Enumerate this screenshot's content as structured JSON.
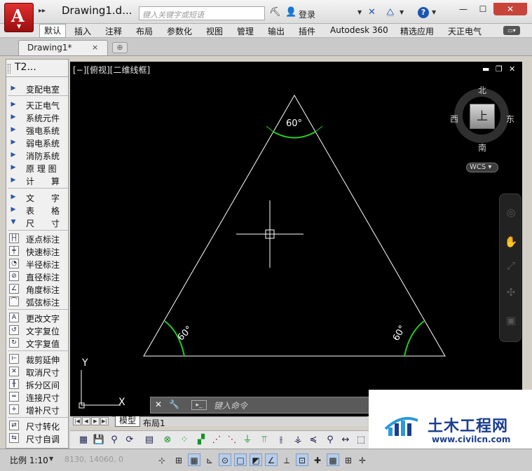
{
  "titlebar": {
    "app_glyph": "A",
    "title": "Drawing1.d...",
    "search_placeholder": "键入关键字或短语",
    "login": "登录"
  },
  "ribbon": {
    "tabs": [
      "默认",
      "插入",
      "注释",
      "布局",
      "参数化",
      "视图",
      "管理",
      "输出",
      "插件",
      "Autodesk 360",
      "精选应用",
      "天正电气"
    ]
  },
  "doc_tabs": {
    "active": "Drawing1*",
    "close": "×"
  },
  "palette": {
    "title": "T2...",
    "categories": [
      "变配电室",
      "天正电气",
      "系统元件",
      "强电系统",
      "弱电系统",
      "消防系统",
      "原 理 图",
      "计　　算",
      "文　　字",
      "表　　格",
      "尺　　寸"
    ],
    "tools": [
      "逐点标注",
      "快速标注",
      "半径标注",
      "直径标注",
      "角度标注",
      "弧弦标注",
      "更改文字",
      "文字复位",
      "文字复值",
      "裁剪延伸",
      "取消尺寸",
      "拆分区间",
      "连接尺寸",
      "增补尺寸",
      "尺寸转化",
      "尺寸自调"
    ]
  },
  "viewport": {
    "label": "[−][俯视][二维线框]",
    "compass": {
      "north": "北",
      "south": "南",
      "east": "东",
      "west": "西",
      "top": "上"
    },
    "wcs": "WCS",
    "angles": {
      "top": "60°",
      "left": "60°",
      "right": "60°"
    }
  },
  "command": {
    "placeholder": "键入命令"
  },
  "layout_tabs": {
    "model": "模型",
    "layout1": "布局1"
  },
  "status": {
    "scale": "比例 1:10",
    "coords": "8130, 14060, 0"
  },
  "watermark": {
    "name": "土木工程网",
    "url": "www.civilcn.com"
  },
  "colors": {
    "canvas": "#000000",
    "geometry": "#ffffff",
    "dimension": "#22cc22",
    "accent_red": "#c81e1e"
  }
}
